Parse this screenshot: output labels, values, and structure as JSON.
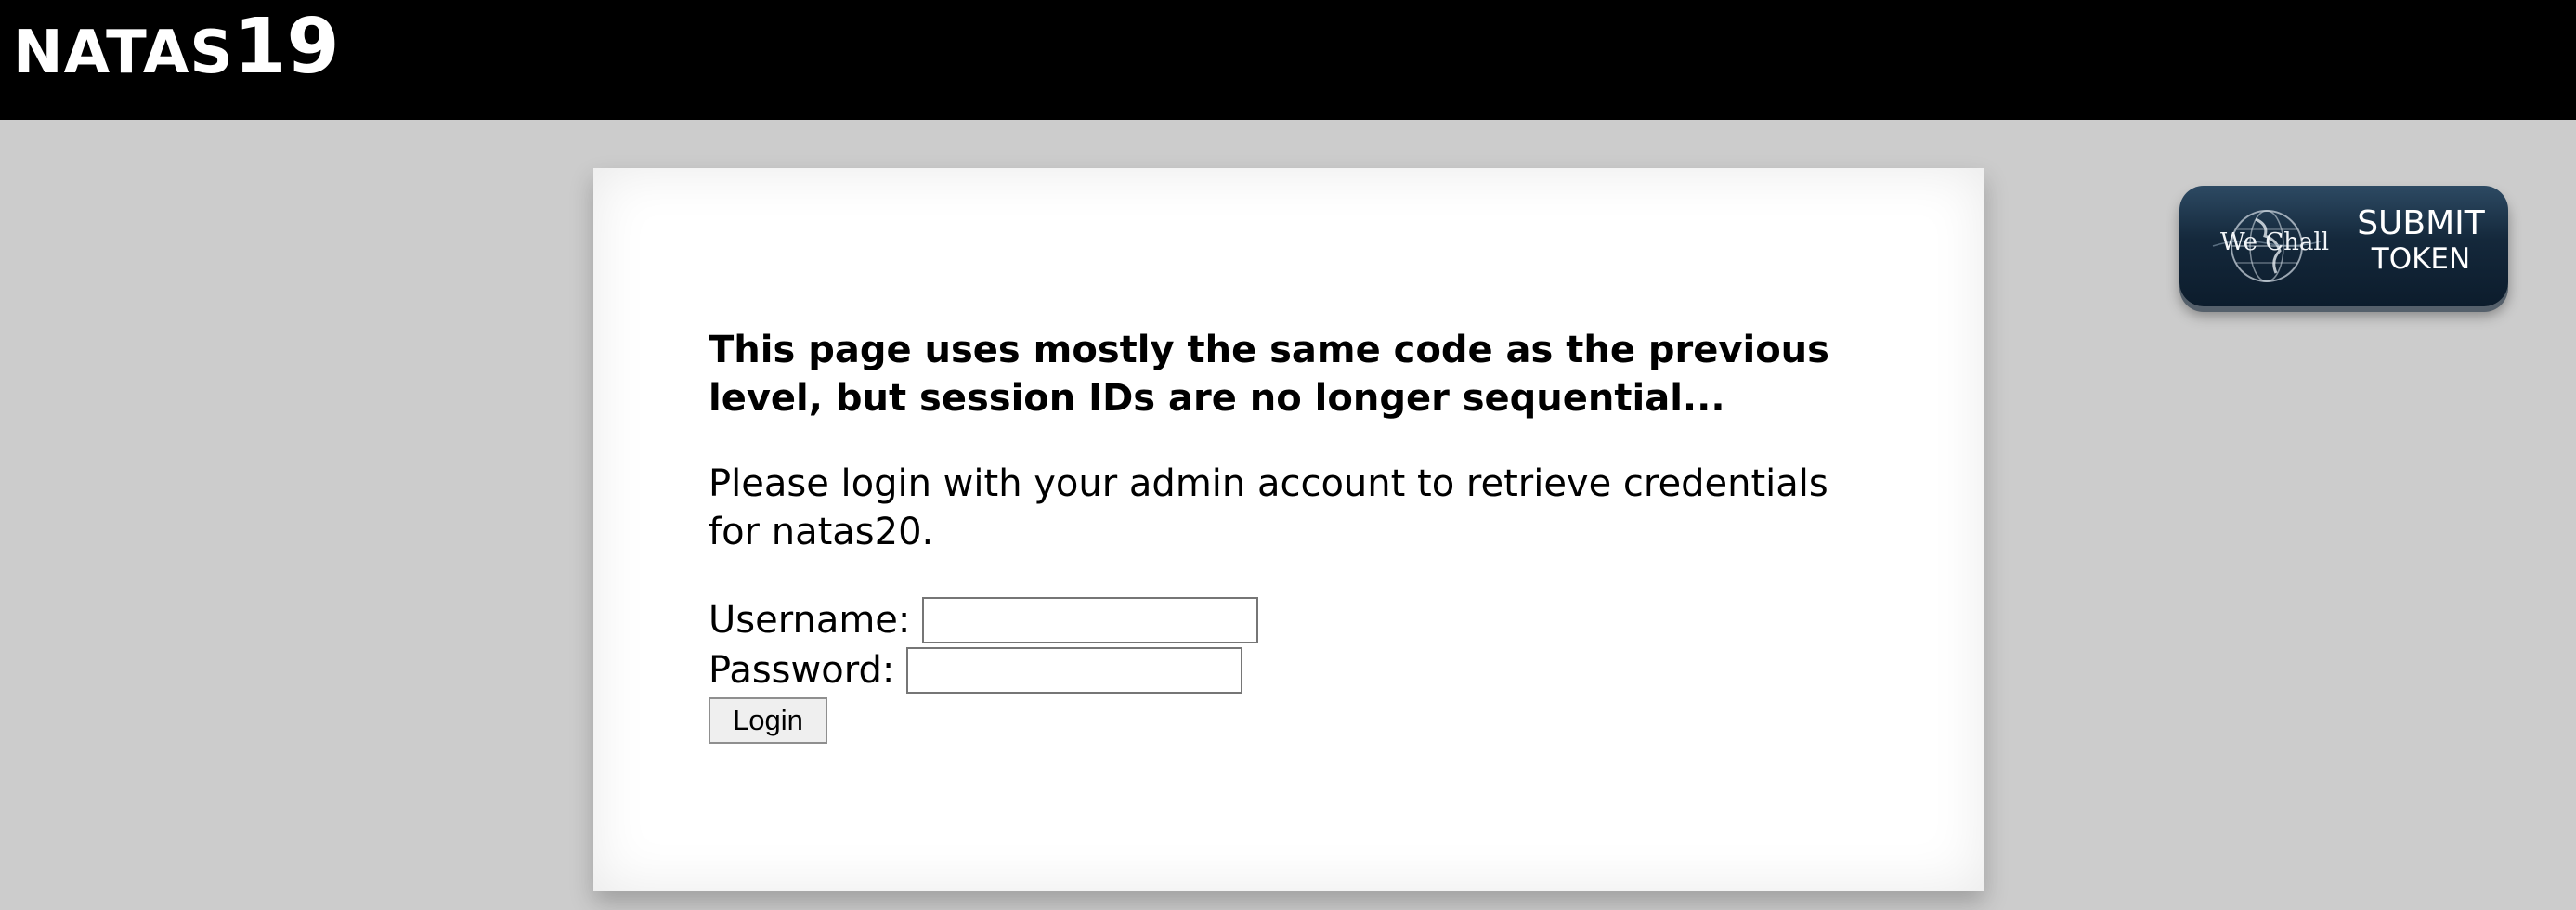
{
  "header": {
    "title_letters": "NATAS",
    "title_number": "19"
  },
  "content": {
    "intro": "This page uses mostly the same code as the previous level, but session IDs are no longer sequential...",
    "prompt": "Please login with your admin account to retrieve credentials for natas20.",
    "username_label": "Username:",
    "username_value": "",
    "password_label": "Password:",
    "password_value": "",
    "login_label": "Login"
  },
  "wechall": {
    "brand": "We Chall",
    "submit_line1": "SUBMIT",
    "submit_line2": "TOKEN",
    "icon": "globe-icon"
  },
  "colors": {
    "header_bg": "#000000",
    "page_bg": "#cccccc",
    "content_bg": "#ffffff",
    "wechall_bg": "#14283b"
  }
}
